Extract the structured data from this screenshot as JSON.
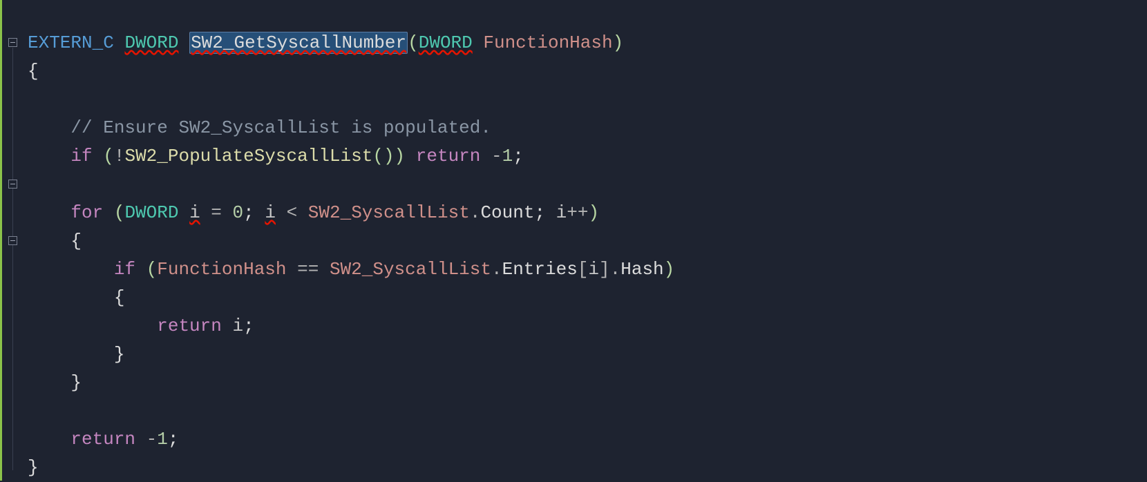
{
  "code": {
    "line1": {
      "extern": "EXTERN_C",
      "type1": "DWORD",
      "funcname": "SW2_GetSyscallNumber",
      "paren_open": "(",
      "type2": "DWORD",
      "param": "FunctionHash",
      "paren_close": ")"
    },
    "line2": {
      "brace": "{"
    },
    "line3": {
      "comment": "// Ensure SW2_SyscallList is populated."
    },
    "line4": {
      "if": "if",
      "po": "(",
      "bang": "!",
      "call": "SW2_PopulateSyscallList",
      "callpo": "(",
      "callpc": ")",
      "pc": ")",
      "ret": "return",
      "neg": "-",
      "one": "1",
      "semi": ";"
    },
    "line5": {
      "for": "for",
      "po": "(",
      "type": "DWORD",
      "var": "i",
      "eq": "=",
      "zero": "0",
      "semi1": ";",
      "var2": "i",
      "lt": "<",
      "list": "SW2_SyscallList",
      "dot1": ".",
      "count": "Count",
      "semi2": ";",
      "var3": "i",
      "pp": "++",
      "pc": ")"
    },
    "line6": {
      "brace": "{"
    },
    "line7": {
      "if": "if",
      "po": "(",
      "param": "FunctionHash",
      "eqeq": "==",
      "list": "SW2_SyscallList",
      "dot1": ".",
      "entries": "Entries",
      "lb": "[",
      "idx": "i",
      "rb": "]",
      "dot2": ".",
      "hash": "Hash",
      "pc": ")"
    },
    "line8": {
      "brace": "{"
    },
    "line9": {
      "ret": "return",
      "var": "i",
      "semi": ";"
    },
    "line10": {
      "brace": "}"
    },
    "line11": {
      "brace": "}"
    },
    "line12": {
      "ret": "return",
      "neg": "-",
      "one": "1",
      "semi": ";"
    },
    "line13": {
      "brace": "}"
    }
  }
}
